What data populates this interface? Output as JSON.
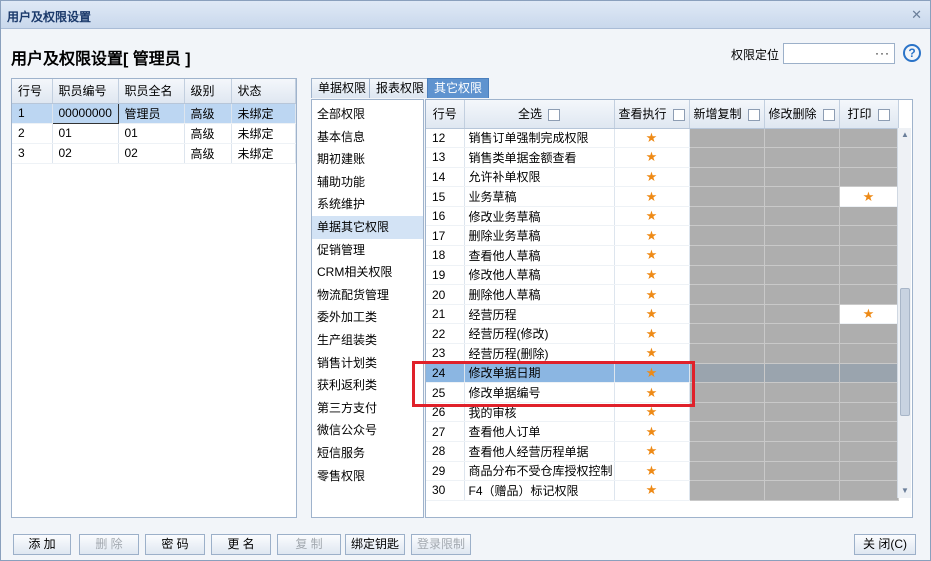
{
  "window": {
    "title": "用户及权限设置"
  },
  "header": {
    "title": "用户及权限设置[ 管理员 ]"
  },
  "locate": {
    "label": "权限定位",
    "value": "",
    "button": "···"
  },
  "employees": {
    "columns": [
      "行号",
      "职员编号",
      "职员全名",
      "级别",
      "状态"
    ],
    "rows": [
      {
        "no": "1",
        "code": "00000000",
        "name": "管理员",
        "level": "高级",
        "status": "未绑定"
      },
      {
        "no": "2",
        "code": "01",
        "name": "01",
        "level": "高级",
        "status": "未绑定"
      },
      {
        "no": "3",
        "code": "02",
        "name": "02",
        "level": "高级",
        "status": "未绑定"
      }
    ]
  },
  "tabs": [
    "单据权限",
    "报表权限",
    "其它权限"
  ],
  "categories": [
    "全部权限",
    "基本信息",
    "期初建账",
    "辅助功能",
    "系统维护",
    "单据其它权限",
    "促销管理",
    "CRM相关权限",
    "物流配货管理",
    "委外加工类",
    "生产组装类",
    "销售计划类",
    "获利返利类",
    "第三方支付",
    "微信公众号",
    "短信服务",
    "零售权限"
  ],
  "perm": {
    "columns": [
      "行号",
      "全选",
      "查看执行",
      "新增复制",
      "修改删除",
      "打印"
    ],
    "rows": [
      {
        "no": "12",
        "name": "销售订单强制完成权限",
        "c1": "★",
        "c4": ""
      },
      {
        "no": "13",
        "name": "销售类单据金额查看",
        "c1": "★",
        "c4": ""
      },
      {
        "no": "14",
        "name": "允许补单权限",
        "c1": "★",
        "c4": ""
      },
      {
        "no": "15",
        "name": "业务草稿",
        "c1": "★",
        "c4": "★"
      },
      {
        "no": "16",
        "name": "修改业务草稿",
        "c1": "★",
        "c4": ""
      },
      {
        "no": "17",
        "name": "删除业务草稿",
        "c1": "★",
        "c4": ""
      },
      {
        "no": "18",
        "name": "查看他人草稿",
        "c1": "★",
        "c4": ""
      },
      {
        "no": "19",
        "name": "修改他人草稿",
        "c1": "★",
        "c4": ""
      },
      {
        "no": "20",
        "name": "删除他人草稿",
        "c1": "★",
        "c4": ""
      },
      {
        "no": "21",
        "name": "经营历程",
        "c1": "★",
        "c4": "★"
      },
      {
        "no": "22",
        "name": "经营历程(修改)",
        "c1": "★",
        "c4": ""
      },
      {
        "no": "23",
        "name": "经营历程(删除)",
        "c1": "★",
        "c4": ""
      },
      {
        "no": "24",
        "name": "修改单据日期",
        "c1": "★",
        "c4": ""
      },
      {
        "no": "25",
        "name": "修改单据编号",
        "c1": "★",
        "c4": ""
      },
      {
        "no": "26",
        "name": "我的审核",
        "c1": "★",
        "c4": ""
      },
      {
        "no": "27",
        "name": "查看他人订单",
        "c1": "★",
        "c4": ""
      },
      {
        "no": "28",
        "name": "查看他人经营历程单据",
        "c1": "★",
        "c4": ""
      },
      {
        "no": "29",
        "name": "商品分布不受仓库授权控制",
        "c1": "★",
        "c4": ""
      },
      {
        "no": "30",
        "name": "F4（赠品）标记权限",
        "c1": "★",
        "c4": ""
      }
    ]
  },
  "buttons": {
    "add": "添 加",
    "delete": "删 除",
    "password": "密 码",
    "rename": "更 名",
    "copy": "复 制",
    "bindkey": "绑定钥匙",
    "loginlimit": "登录限制",
    "close": "关 闭(C)"
  }
}
